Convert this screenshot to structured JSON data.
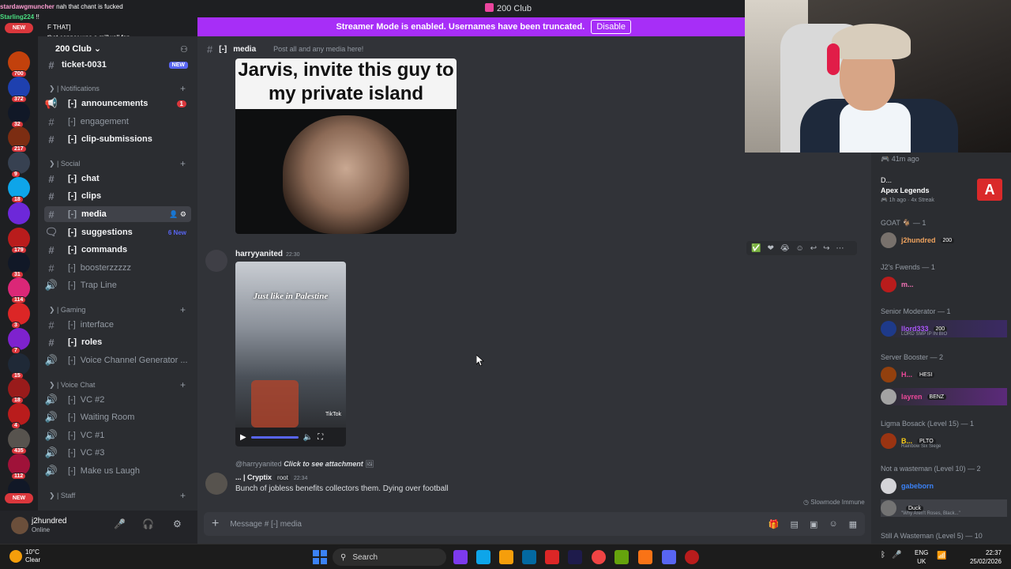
{
  "window": {
    "title": "200 Club"
  },
  "banner": {
    "text": "Streamer Mode is enabled. Usernames have been truncated.",
    "disable_label": "Disable"
  },
  "overlay_chat": [
    {
      "user": "stardawgmuncher",
      "text": "nah that chant is fucked"
    },
    {
      "user": "Starling224",
      "text": "!!"
    },
    {
      "user": "",
      "text": "F THAT]"
    },
    {
      "user": "",
      "text": "that copper was a millwall fan"
    }
  ],
  "servers": [
    {
      "count": "700",
      "color": "#c2410c"
    },
    {
      "count": "372",
      "color": "#1e40af"
    },
    {
      "count": "32",
      "color": "#111827"
    },
    {
      "count": "217",
      "color": "#7c2d12"
    },
    {
      "count": "9",
      "color": "#374151"
    },
    {
      "count": "18",
      "color": "#0ea5e9"
    },
    {
      "count": "",
      "color": "#6d28d9"
    },
    {
      "count": "179",
      "color": "#b91c1c"
    },
    {
      "count": "31",
      "color": "#111827"
    },
    {
      "count": "114",
      "color": "#db2777"
    },
    {
      "count": "3",
      "color": "#dc2626"
    },
    {
      "count": "7",
      "color": "#7e22ce"
    },
    {
      "count": "15",
      "color": "#1f2937"
    },
    {
      "count": "18",
      "color": "#991b1b"
    },
    {
      "count": "4",
      "color": "#b91c1c"
    },
    {
      "count": "435",
      "color": "#57534e"
    },
    {
      "count": "112",
      "color": "#9f1239"
    },
    {
      "count": "",
      "color": "#111827"
    }
  ],
  "server": {
    "name": "200 Club",
    "badge_new": "NEW",
    "new_label": "NEW"
  },
  "channels": {
    "ticket": {
      "name": "ticket-0031",
      "tag": "NEW"
    },
    "cat_notifications": "| Notifications",
    "announcements": {
      "name": "announcements",
      "badge": "1"
    },
    "engagement": {
      "name": "engagement"
    },
    "clip_submissions": {
      "name": "clip-submissions"
    },
    "cat_social": "| Social",
    "chat": {
      "name": "chat"
    },
    "clips": {
      "name": "clips"
    },
    "media": {
      "name": "media"
    },
    "suggestions": {
      "name": "suggestions",
      "new": "6 New"
    },
    "commands": {
      "name": "commands"
    },
    "booster": {
      "name": "boosterzzzzz"
    },
    "trapline": {
      "name": "Trap Line"
    },
    "cat_gaming": "| Gaming",
    "interface": {
      "name": "interface"
    },
    "roles": {
      "name": "roles"
    },
    "vcgen": {
      "name": "Voice Channel Generator ..."
    },
    "cat_voice": "| Voice Chat",
    "vc2": {
      "name": "VC #2"
    },
    "waiting": {
      "name": "Waiting Room"
    },
    "vc1": {
      "name": "VC #1"
    },
    "vc3": {
      "name": "VC #3"
    },
    "laugh": {
      "name": "Make us Laugh"
    },
    "cat_staff": "| Staff",
    "prefix": "[-]"
  },
  "user": {
    "name": "j2hundred",
    "status": "Online"
  },
  "header": {
    "channel": "media",
    "prefix": "[-]",
    "topic": "Post all and any media here!"
  },
  "messages": {
    "meme_caption": "Jarvis, invite this guy to my private island",
    "m2": {
      "author": "harryyanited",
      "time": "22:30",
      "video_caption": "Just like in Palestine",
      "watermark": "TikTok"
    },
    "reply": {
      "ref": "@harryyanited",
      "hint": "Click to see attachment"
    },
    "m3": {
      "author": "... | Cryptix",
      "tag": "root",
      "time": "22:34",
      "text": "Bunch of jobless benefits collectors them. Dying over football"
    }
  },
  "composer": {
    "placeholder": "Message #  [-]  media"
  },
  "slowmode": "Slowmode Immune",
  "members": {
    "activity_time": "41m ago",
    "game_user": "D...",
    "game": "Apex Legends",
    "game_meta": "1h ago",
    "game_streak": "4x Streak",
    "sections": [
      {
        "label": "GOAT 🐐 — 1"
      },
      {
        "label": "J2's Fwends — 1"
      },
      {
        "label": "Senior Moderator — 1"
      },
      {
        "label": "Server Booster — 2"
      },
      {
        "label": "Ligma Bosack (Level 15) — 1"
      },
      {
        "label": "Not a wasteman (Level 10) — 2"
      },
      {
        "label": "Still A Wasteman (Level 5) — 10"
      }
    ],
    "people": [
      {
        "name": "j2hundred",
        "tag": "200",
        "color": "#f0a35e"
      },
      {
        "name": "m...",
        "tag": "",
        "color": "#f472b6"
      },
      {
        "name": "llord333",
        "tag": "200",
        "color": "#a855f7",
        "sub": "LORD SMP IP IN BIO"
      },
      {
        "name": "H...",
        "tag": "HESI",
        "color": "#ec4899"
      },
      {
        "name": "layren",
        "tag": "BENZ",
        "color": "#ec4899"
      },
      {
        "name": "B...",
        "tag": "PLTO",
        "color": "#facc15",
        "sub": "Rainbow Six Siege"
      },
      {
        "name": "gabeborn",
        "tag": "",
        "color": "#3b82f6"
      },
      {
        "name": "",
        "tag": "Duck",
        "color": "#3b82f6",
        "sub": "\"Why Aren't Roses, Black...\""
      }
    ]
  },
  "taskbar": {
    "weather_temp": "10°C",
    "weather_text": "Clear",
    "search": "Search",
    "lang1": "ENG",
    "lang2": "UK",
    "time": "22:37",
    "date": "25/02/2026"
  }
}
